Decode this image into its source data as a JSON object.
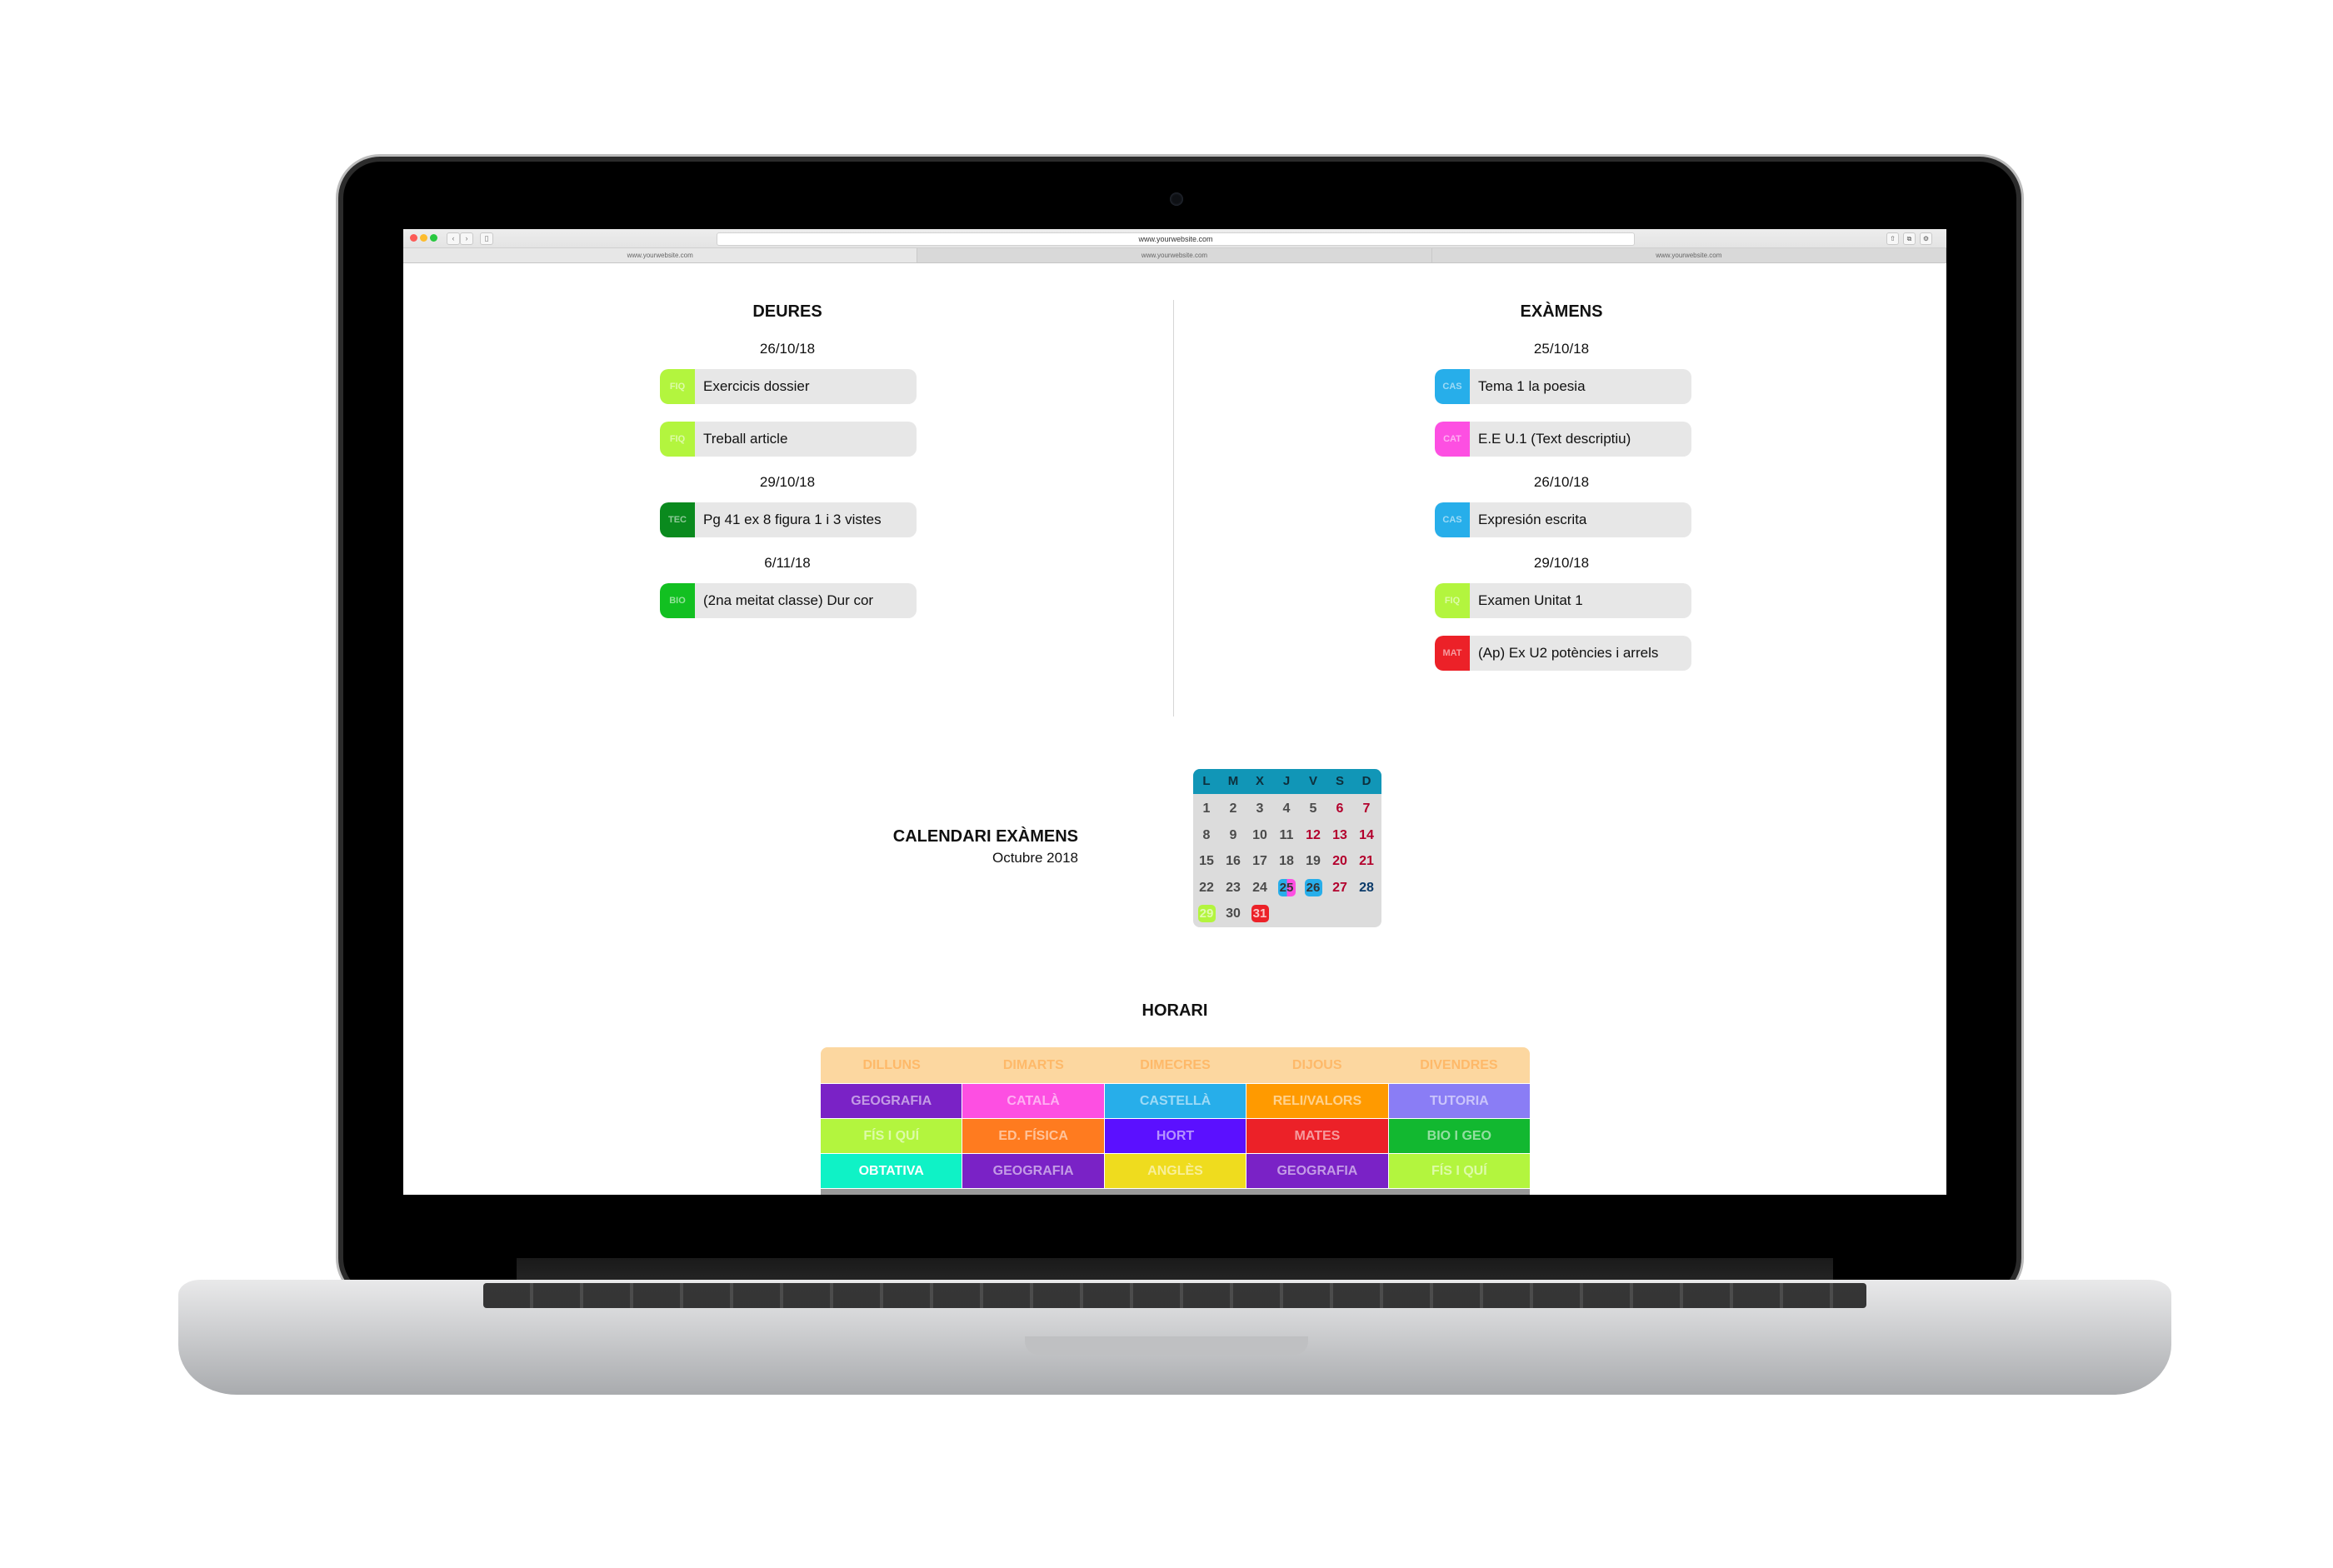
{
  "browser": {
    "url": "www.yourwebsite.com",
    "tabs": [
      "www.yourwebsite.com",
      "www.yourwebsite.com",
      "www.yourwebsite.com"
    ]
  },
  "deures": {
    "title": "DEURES",
    "groups": [
      {
        "date": "26/10/18",
        "items": [
          {
            "tag": "FIQ",
            "color": "#b3f53e",
            "text": "Exercicis dossier"
          },
          {
            "tag": "FIQ",
            "color": "#b3f53e",
            "text": "Treball article"
          }
        ]
      },
      {
        "date": "29/10/18",
        "items": [
          {
            "tag": "TEC",
            "color": "#0a8a1e",
            "text": "Pg 41 ex 8 figura 1 i 3 vistes"
          }
        ]
      },
      {
        "date": "6/11/18",
        "items": [
          {
            "tag": "BIO",
            "color": "#12c021",
            "text": "(2na meitat classe) Dur cor"
          }
        ]
      }
    ]
  },
  "examens": {
    "title": "EXÀMENS",
    "groups": [
      {
        "date": "25/10/18",
        "items": [
          {
            "tag": "CAS",
            "color": "#27aeea",
            "text": "Tema 1 la poesia"
          },
          {
            "tag": "CAT",
            "color": "#fd4fe2",
            "text": "E.E U.1 (Text descriptiu)"
          }
        ]
      },
      {
        "date": "26/10/18",
        "items": [
          {
            "tag": "CAS",
            "color": "#27aeea",
            "text": "Expresión escrita"
          }
        ]
      },
      {
        "date": "29/10/18",
        "items": [
          {
            "tag": "FIQ",
            "color": "#b3f53e",
            "text": "Examen Unitat 1"
          },
          {
            "tag": "MAT",
            "color": "#ec2128",
            "text": "(Ap) Ex U2 potències i arrels"
          }
        ]
      }
    ]
  },
  "calendar": {
    "title": "CALENDARI EXÀMENS",
    "month": "Octubre 2018",
    "weekdays": [
      "L",
      "M",
      "X",
      "J",
      "V",
      "S",
      "D"
    ],
    "days": [
      {
        "n": "1"
      },
      {
        "n": "2"
      },
      {
        "n": "3"
      },
      {
        "n": "4"
      },
      {
        "n": "5"
      },
      {
        "n": "6",
        "we": true
      },
      {
        "n": "7",
        "we": true
      },
      {
        "n": "8"
      },
      {
        "n": "9"
      },
      {
        "n": "10"
      },
      {
        "n": "11"
      },
      {
        "n": "12",
        "we": true
      },
      {
        "n": "13",
        "we": true
      },
      {
        "n": "14",
        "we": true
      },
      {
        "n": "15"
      },
      {
        "n": "16"
      },
      {
        "n": "17"
      },
      {
        "n": "18"
      },
      {
        "n": "19"
      },
      {
        "n": "20",
        "we": true
      },
      {
        "n": "21",
        "we": true
      },
      {
        "n": "22"
      },
      {
        "n": "23"
      },
      {
        "n": "24"
      },
      {
        "n": "25",
        "chip": "linear-gradient(90deg,#27aeea 50%,#fd4fe2 50%)"
      },
      {
        "n": "26",
        "chip": "#27aeea"
      },
      {
        "n": "27",
        "we": true
      },
      {
        "n": "28",
        "blue": true
      },
      {
        "n": "29",
        "chip": "#b3f53e"
      },
      {
        "n": "30"
      },
      {
        "n": "31",
        "chip": "#ec2128"
      }
    ]
  },
  "horari": {
    "title": "HORARI",
    "days": [
      "DILLUNS",
      "DIMARTS",
      "DIMECRES",
      "DIJOUS",
      "DIVENDRES"
    ],
    "rows": [
      [
        {
          "label": "GEOGRAFIA",
          "color": "#7a22c6"
        },
        {
          "label": "CATALÀ",
          "color": "#fd4fe2"
        },
        {
          "label": "CASTELLÀ",
          "color": "#27aeea"
        },
        {
          "label": "RELI/VALORS",
          "color": "#ff9a00"
        },
        {
          "label": "TUTORIA",
          "color": "#8a7df5"
        }
      ],
      [
        {
          "label": "FÍS I QUÍ",
          "color": "#b3f53e"
        },
        {
          "label": "ED. FÍSICA",
          "color": "#ff7b1f"
        },
        {
          "label": "HORT",
          "color": "#5b10ff"
        },
        {
          "label": "MATES",
          "color": "#ec2128"
        },
        {
          "label": "BIO I GEO",
          "color": "#12b830"
        }
      ],
      [
        {
          "label": "OBTATIVA",
          "color": "#0ff2c6",
          "strong": true
        },
        {
          "label": "GEOGRAFIA",
          "color": "#7a22c6"
        },
        {
          "label": "ANGLÈS",
          "color": "#efdc1e"
        },
        {
          "label": "GEOGRAFIA",
          "color": "#7a22c6"
        },
        {
          "label": "FÍS I QUÍ",
          "color": "#b3f53e"
        }
      ]
    ]
  }
}
